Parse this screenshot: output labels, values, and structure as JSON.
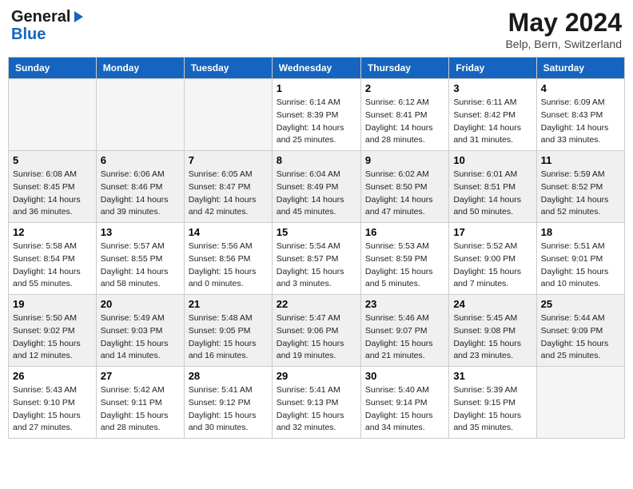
{
  "header": {
    "logo_line1": "General",
    "logo_line2": "Blue",
    "month_title": "May 2024",
    "subtitle": "Belp, Bern, Switzerland"
  },
  "weekdays": [
    "Sunday",
    "Monday",
    "Tuesday",
    "Wednesday",
    "Thursday",
    "Friday",
    "Saturday"
  ],
  "weeks": [
    [
      {
        "day": "",
        "info": ""
      },
      {
        "day": "",
        "info": ""
      },
      {
        "day": "",
        "info": ""
      },
      {
        "day": "1",
        "info": "Sunrise: 6:14 AM\nSunset: 8:39 PM\nDaylight: 14 hours\nand 25 minutes."
      },
      {
        "day": "2",
        "info": "Sunrise: 6:12 AM\nSunset: 8:41 PM\nDaylight: 14 hours\nand 28 minutes."
      },
      {
        "day": "3",
        "info": "Sunrise: 6:11 AM\nSunset: 8:42 PM\nDaylight: 14 hours\nand 31 minutes."
      },
      {
        "day": "4",
        "info": "Sunrise: 6:09 AM\nSunset: 8:43 PM\nDaylight: 14 hours\nand 33 minutes."
      }
    ],
    [
      {
        "day": "5",
        "info": "Sunrise: 6:08 AM\nSunset: 8:45 PM\nDaylight: 14 hours\nand 36 minutes."
      },
      {
        "day": "6",
        "info": "Sunrise: 6:06 AM\nSunset: 8:46 PM\nDaylight: 14 hours\nand 39 minutes."
      },
      {
        "day": "7",
        "info": "Sunrise: 6:05 AM\nSunset: 8:47 PM\nDaylight: 14 hours\nand 42 minutes."
      },
      {
        "day": "8",
        "info": "Sunrise: 6:04 AM\nSunset: 8:49 PM\nDaylight: 14 hours\nand 45 minutes."
      },
      {
        "day": "9",
        "info": "Sunrise: 6:02 AM\nSunset: 8:50 PM\nDaylight: 14 hours\nand 47 minutes."
      },
      {
        "day": "10",
        "info": "Sunrise: 6:01 AM\nSunset: 8:51 PM\nDaylight: 14 hours\nand 50 minutes."
      },
      {
        "day": "11",
        "info": "Sunrise: 5:59 AM\nSunset: 8:52 PM\nDaylight: 14 hours\nand 52 minutes."
      }
    ],
    [
      {
        "day": "12",
        "info": "Sunrise: 5:58 AM\nSunset: 8:54 PM\nDaylight: 14 hours\nand 55 minutes."
      },
      {
        "day": "13",
        "info": "Sunrise: 5:57 AM\nSunset: 8:55 PM\nDaylight: 14 hours\nand 58 minutes."
      },
      {
        "day": "14",
        "info": "Sunrise: 5:56 AM\nSunset: 8:56 PM\nDaylight: 15 hours\nand 0 minutes."
      },
      {
        "day": "15",
        "info": "Sunrise: 5:54 AM\nSunset: 8:57 PM\nDaylight: 15 hours\nand 3 minutes."
      },
      {
        "day": "16",
        "info": "Sunrise: 5:53 AM\nSunset: 8:59 PM\nDaylight: 15 hours\nand 5 minutes."
      },
      {
        "day": "17",
        "info": "Sunrise: 5:52 AM\nSunset: 9:00 PM\nDaylight: 15 hours\nand 7 minutes."
      },
      {
        "day": "18",
        "info": "Sunrise: 5:51 AM\nSunset: 9:01 PM\nDaylight: 15 hours\nand 10 minutes."
      }
    ],
    [
      {
        "day": "19",
        "info": "Sunrise: 5:50 AM\nSunset: 9:02 PM\nDaylight: 15 hours\nand 12 minutes."
      },
      {
        "day": "20",
        "info": "Sunrise: 5:49 AM\nSunset: 9:03 PM\nDaylight: 15 hours\nand 14 minutes."
      },
      {
        "day": "21",
        "info": "Sunrise: 5:48 AM\nSunset: 9:05 PM\nDaylight: 15 hours\nand 16 minutes."
      },
      {
        "day": "22",
        "info": "Sunrise: 5:47 AM\nSunset: 9:06 PM\nDaylight: 15 hours\nand 19 minutes."
      },
      {
        "day": "23",
        "info": "Sunrise: 5:46 AM\nSunset: 9:07 PM\nDaylight: 15 hours\nand 21 minutes."
      },
      {
        "day": "24",
        "info": "Sunrise: 5:45 AM\nSunset: 9:08 PM\nDaylight: 15 hours\nand 23 minutes."
      },
      {
        "day": "25",
        "info": "Sunrise: 5:44 AM\nSunset: 9:09 PM\nDaylight: 15 hours\nand 25 minutes."
      }
    ],
    [
      {
        "day": "26",
        "info": "Sunrise: 5:43 AM\nSunset: 9:10 PM\nDaylight: 15 hours\nand 27 minutes."
      },
      {
        "day": "27",
        "info": "Sunrise: 5:42 AM\nSunset: 9:11 PM\nDaylight: 15 hours\nand 28 minutes."
      },
      {
        "day": "28",
        "info": "Sunrise: 5:41 AM\nSunset: 9:12 PM\nDaylight: 15 hours\nand 30 minutes."
      },
      {
        "day": "29",
        "info": "Sunrise: 5:41 AM\nSunset: 9:13 PM\nDaylight: 15 hours\nand 32 minutes."
      },
      {
        "day": "30",
        "info": "Sunrise: 5:40 AM\nSunset: 9:14 PM\nDaylight: 15 hours\nand 34 minutes."
      },
      {
        "day": "31",
        "info": "Sunrise: 5:39 AM\nSunset: 9:15 PM\nDaylight: 15 hours\nand 35 minutes."
      },
      {
        "day": "",
        "info": ""
      }
    ]
  ]
}
